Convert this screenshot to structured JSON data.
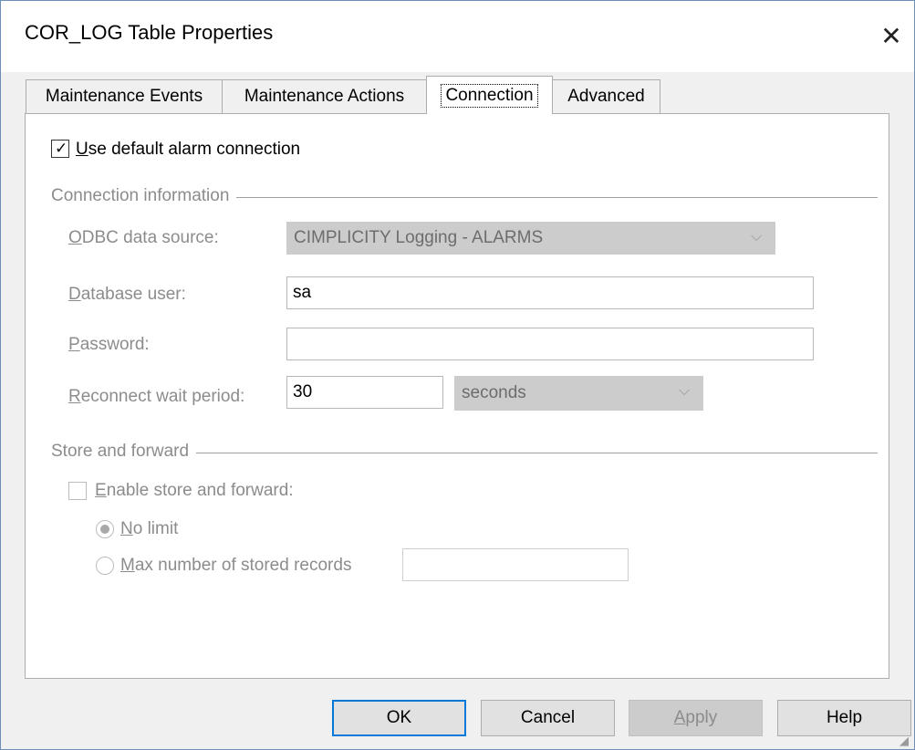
{
  "window": {
    "title": "COR_LOG Table Properties"
  },
  "tabs": [
    {
      "label": "Maintenance Events"
    },
    {
      "label": "Maintenance Actions"
    },
    {
      "label": "Connection"
    },
    {
      "label": "Advanced"
    }
  ],
  "connection": {
    "use_default": {
      "label_u": "U",
      "label_rest": "se default alarm connection",
      "checked": true
    },
    "group_label": "Connection information",
    "odbc": {
      "label_u": "O",
      "label_rest": "DBC data source:",
      "value": "CIMPLICITY Logging - ALARMS"
    },
    "db_user": {
      "label_u": "D",
      "label_rest": "atabase user:",
      "value": "sa"
    },
    "password": {
      "label_u": "P",
      "label_rest": "assword:",
      "value": ""
    },
    "reconnect": {
      "label_u": "R",
      "label_rest": "econnect wait period:",
      "value": "30",
      "unit": "seconds"
    }
  },
  "store_forward": {
    "group_label": "Store and forward",
    "enable": {
      "label_u": "E",
      "label_rest": "nable store and forward:",
      "checked": false
    },
    "no_limit": {
      "label_u": "N",
      "label_rest": "o limit",
      "selected": true
    },
    "max_records": {
      "label_u": "M",
      "label_rest": "ax number of stored records",
      "selected": false,
      "value": ""
    }
  },
  "buttons": {
    "ok": "OK",
    "cancel": "Cancel",
    "apply_u": "A",
    "apply_rest": "pply",
    "help": "Help"
  },
  "icons": {
    "close": "✕",
    "chevron": "⌵",
    "check": "✓",
    "grip": "◢"
  }
}
